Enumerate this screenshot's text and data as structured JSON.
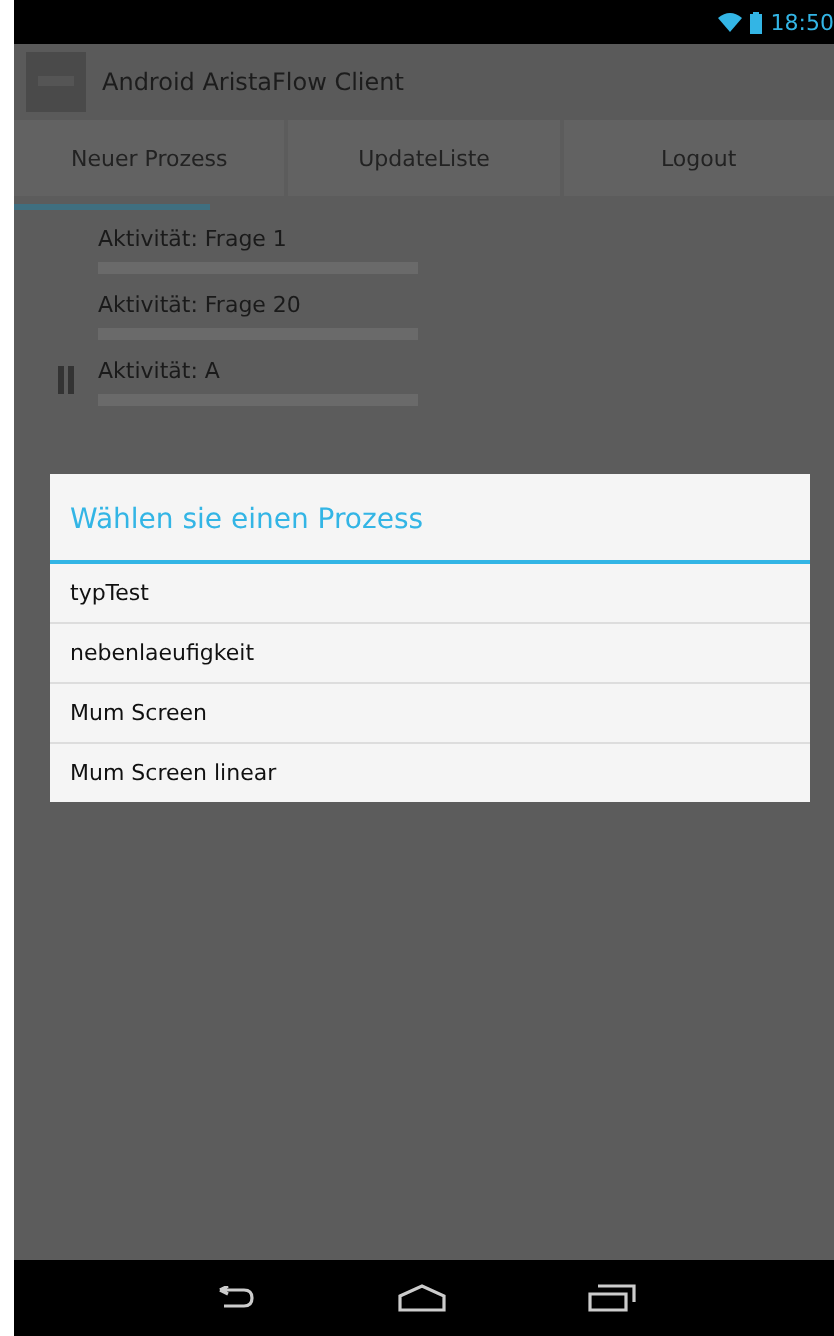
{
  "status_bar": {
    "time": "18:50"
  },
  "action_bar": {
    "title": "Android AristaFlow Client"
  },
  "buttons": [
    "Neuer Prozess",
    "UpdateListe",
    "Logout"
  ],
  "activities": [
    {
      "title": "Aktivität: Frage 1"
    },
    {
      "title": "Aktivität: Frage 20"
    },
    {
      "title": "Aktivität: A"
    }
  ],
  "dialog": {
    "title": "Wählen sie einen Prozess",
    "items": [
      "typTest",
      "nebenlaeufigkeit",
      "Mum Screen",
      "Mum Screen linear"
    ]
  }
}
